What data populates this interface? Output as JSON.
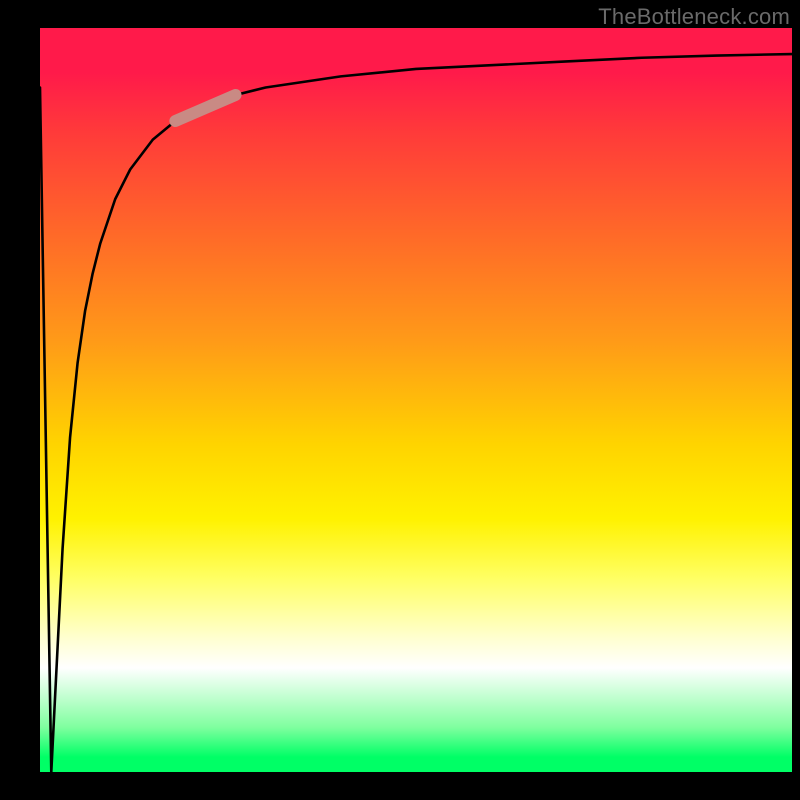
{
  "attribution": "TheBottleneck.com",
  "colors": {
    "page_bg": "#000000",
    "attribution": "#6a6a6a",
    "curve": "#000000",
    "highlight": "#c98a84",
    "gradient_top": "#ff1a4a",
    "gradient_bottom": "#00ff66"
  },
  "chart_data": {
    "type": "line",
    "title": "",
    "xlabel": "",
    "ylabel": "",
    "xlim": [
      0,
      100
    ],
    "ylim": [
      0,
      100
    ],
    "grid": false,
    "legend": false,
    "series": [
      {
        "name": "curve",
        "x": [
          0,
          1.5,
          3,
          4,
          5,
          6,
          7,
          8,
          10,
          12,
          15,
          18,
          22,
          26,
          30,
          40,
          50,
          60,
          70,
          80,
          90,
          100
        ],
        "y": [
          92,
          0,
          30,
          45,
          55,
          62,
          67,
          71,
          77,
          81,
          85,
          87.5,
          89.5,
          91,
          92,
          93.5,
          94.5,
          95,
          95.5,
          96,
          96.3,
          96.5
        ]
      }
    ],
    "highlight_segment": {
      "x_start": 18,
      "x_end": 26,
      "y_start": 87.5,
      "y_end": 91
    },
    "background_gradient": {
      "direction": "vertical",
      "stops": [
        {
          "pos": 0.0,
          "color": "#ff1a4a"
        },
        {
          "pos": 0.28,
          "color": "#ff6a28"
        },
        {
          "pos": 0.56,
          "color": "#ffd400"
        },
        {
          "pos": 0.74,
          "color": "#ffff64"
        },
        {
          "pos": 0.86,
          "color": "#ffffff"
        },
        {
          "pos": 0.94,
          "color": "#7fff9f"
        },
        {
          "pos": 1.0,
          "color": "#00ff66"
        }
      ]
    }
  }
}
